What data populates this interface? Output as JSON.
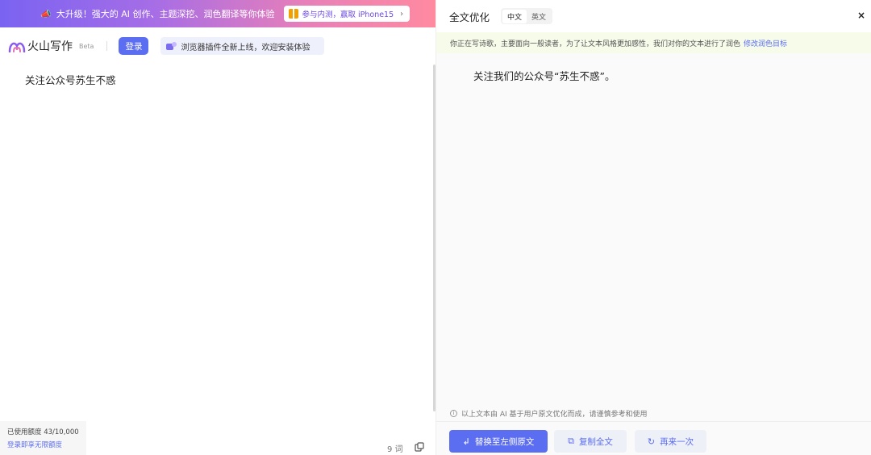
{
  "promo": {
    "text": "大升级！强大的 AI 创作、主题深挖、润色翻译等你体验",
    "cta": "参与内测，赢取 iPhone15"
  },
  "header": {
    "brand": "火山写作",
    "beta": "Beta",
    "login": "登录",
    "extension_notice": "浏览器插件全新上线，欢迎安装体验"
  },
  "editor": {
    "text": "关注公众号苏生不惑",
    "word_count": "9 词"
  },
  "usage": {
    "label": "已使用额度",
    "value": "43/10,000",
    "link": "登录即享无限额度"
  },
  "panel": {
    "title": "全文优化",
    "lang_zh": "中文",
    "lang_en": "英文",
    "close": "×",
    "notice": "你正在写诗歌，主要面向一般读者，为了让文本风格更加感性，我们对你的文本进行了润色",
    "notice_link": "修改润色目标",
    "result": "关注我们的公众号“苏生不惑”。",
    "disclaimer": "以上文本由 AI 基于用户原文优化而成，请谨慎参考和使用",
    "replace_btn": "替换至左侧原文",
    "copy_btn": "复制全文",
    "retry_btn": "再来一次"
  },
  "colors": {
    "accent": "#5b6df0",
    "notice_bg": "#f6fbea"
  }
}
